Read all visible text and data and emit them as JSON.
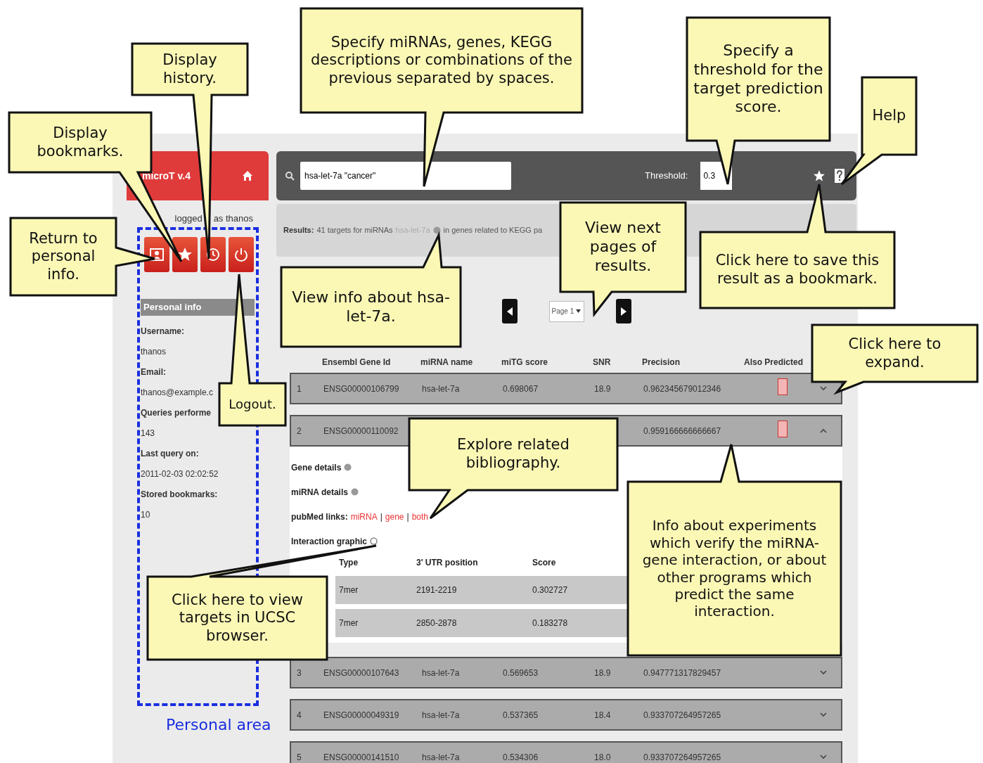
{
  "sidebar": {
    "logo": "microT v.4",
    "logged_in": [
      "logged",
      "as thanos"
    ],
    "personal_info": {
      "title": "Personal info",
      "fields": [
        {
          "label": "Username:",
          "value": "thanos"
        },
        {
          "label": "Email:",
          "value": "thanos@example.c"
        },
        {
          "label": "Queries performe",
          "value": "143"
        },
        {
          "label": "Last query on:",
          "value": "2011-02-03 02:02:52"
        },
        {
          "label": "Stored bookmarks:",
          "value": "10"
        }
      ]
    },
    "area_label": "Personal area"
  },
  "search_bar": {
    "query": "hsa-let-7a \"cancer\"",
    "threshold_label": "Threshold:",
    "threshold": "0.3"
  },
  "results": {
    "label": "Results:",
    "text": "41 targets for miRNAs",
    "mirna": "hsa-let-7a",
    "suffix": "in genes related to KEGG pa"
  },
  "pager": {
    "page": "Page 1"
  },
  "table": {
    "columns": [
      "Ensembl Gene Id",
      "miRNA name",
      "miTG score",
      "SNR",
      "Precision",
      "Also Predicted"
    ],
    "rows": [
      {
        "index": "1",
        "gene_id": "ENSG00000106799",
        "mirna": "hsa-let-7a",
        "mitg_score": "0.698067",
        "snr": "18.9",
        "precision": "0.962345679012346",
        "also_predicted": true,
        "expanded": false
      },
      {
        "index": "2",
        "gene_id": "ENSG00000110092",
        "precision": "0.959166666666667",
        "also_predicted": true,
        "expanded": true,
        "details": {
          "gene_details": "Gene details",
          "mirna_details": "miRNA details",
          "pubmed_label": "pubMed links:",
          "pubmed_links": [
            "miRNA",
            "gene",
            "both"
          ],
          "separator": "|",
          "interaction_graphic": "Interaction graphic",
          "columns": [
            "Type",
            "3' UTR position",
            "Score"
          ],
          "rows": [
            [
              "7mer",
              "2191-2219",
              "0.302727"
            ],
            [
              "7mer",
              "2850-2878",
              "0.183278"
            ]
          ]
        }
      },
      {
        "index": "3",
        "gene_id": "ENSG00000107643",
        "mirna": "hsa-let-7a",
        "mitg_score": "0.569653",
        "snr": "18.9",
        "precision": "0.947771317829457",
        "also_predicted": false,
        "expanded": false
      },
      {
        "index": "4",
        "gene_id": "ENSG00000049319",
        "mirna": "hsa-let-7a",
        "mitg_score": "0.537365",
        "snr": "18.4",
        "precision": "0.933707264957265",
        "also_predicted": false,
        "expanded": false
      },
      {
        "index": "5",
        "gene_id": "ENSG00000141510",
        "mirna": "hsa-let-7a",
        "mitg_score": "0.534306",
        "snr": "18.0",
        "precision": "0.933707264957265",
        "also_predicted": false,
        "expanded": false
      }
    ]
  },
  "callouts": [
    {
      "text": "Display bookmarks."
    },
    {
      "text": "Display history."
    },
    {
      "text": "Specify miRNAs, genes, KEGG descriptions or combinations of the previous separated by spaces."
    },
    {
      "text": "Specify a threshold for the target prediction score."
    },
    {
      "text": "Help"
    },
    {
      "text": "Return to personal info."
    },
    {
      "text": "Logout."
    },
    {
      "text": "View info about hsa-let-7a."
    },
    {
      "text": "View next pages of results."
    },
    {
      "text": "Click here to save this result as a bookmark."
    },
    {
      "text": "Click here to expand."
    },
    {
      "text": "Explore related bibliography."
    },
    {
      "text": "Info about experiments which verify the miRNA-gene interaction, or about other programs which predict the same interaction."
    },
    {
      "text": "Click here to view targets in UCSC browser."
    }
  ]
}
